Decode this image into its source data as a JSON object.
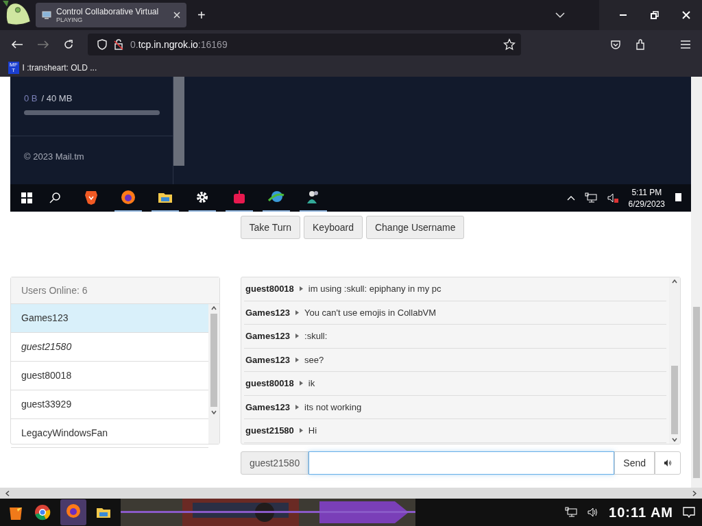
{
  "browser": {
    "tab": {
      "title": "Control Collaborative Virtual",
      "subtitle": "PLAYING",
      "selected": true
    },
    "new_tab": "+",
    "address": {
      "host_dim": "0.",
      "host": "tcp.in.ngrok.io",
      "port": ":16169"
    },
    "bookmark": {
      "badge_top": "MF",
      "badge_bottom": "T",
      "label": "I :transheart: OLD ..."
    }
  },
  "vm_screen": {
    "storage": {
      "used": "0 B",
      "total": "/ 40 MB",
      "level": 0
    },
    "footer": "© 2023 Mail.tm",
    "taskbar": {
      "apps": [
        {
          "kind": "brave",
          "running": false
        },
        {
          "kind": "firefox",
          "running": true
        },
        {
          "kind": "folder",
          "running": true
        },
        {
          "kind": "gear",
          "running": true
        },
        {
          "kind": "robot",
          "running": true
        },
        {
          "kind": "globe",
          "running": true
        },
        {
          "kind": "people",
          "running": true
        }
      ],
      "time": "5:11 PM",
      "date": "6/29/2023"
    }
  },
  "vm_controls": [
    "Take Turn",
    "Keyboard",
    "Change Username"
  ],
  "users": {
    "header": "Users Online: 6",
    "list": [
      {
        "name": "Games123",
        "selected": true,
        "self": false
      },
      {
        "name": "guest21580",
        "selected": false,
        "self": true
      },
      {
        "name": "guest80018",
        "selected": false,
        "self": false
      },
      {
        "name": "guest33929",
        "selected": false,
        "self": false
      },
      {
        "name": "LegacyWindowsFan",
        "selected": false,
        "self": false
      }
    ]
  },
  "chat": [
    {
      "user": "guest80018",
      "text": "im using :skull: epiphany in my pc"
    },
    {
      "user": "Games123",
      "text": "You can't use emojis in CollabVM"
    },
    {
      "user": "Games123",
      "text": ":skull:"
    },
    {
      "user": "Games123",
      "text": "see?"
    },
    {
      "user": "guest80018",
      "text": "ik"
    },
    {
      "user": "Games123",
      "text": "its not working"
    },
    {
      "user": "guest21580",
      "text": "Hi"
    }
  ],
  "chat_input": {
    "username": "guest21580",
    "send": "Send"
  },
  "host_taskbar": {
    "time": "10:11 AM"
  }
}
